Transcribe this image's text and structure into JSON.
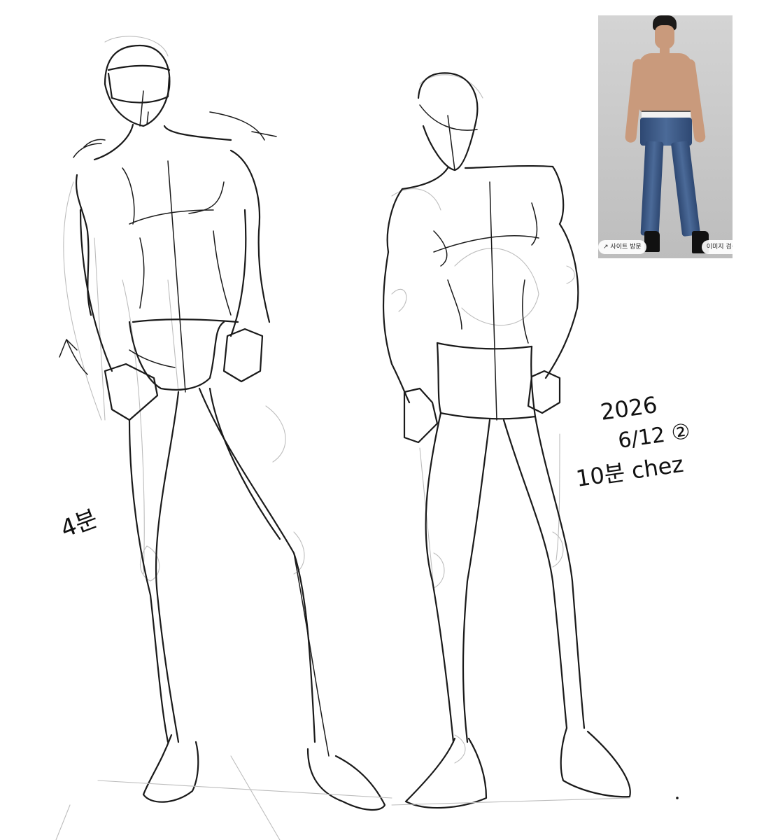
{
  "reference_photo": {
    "visit_label": "사이트 방문",
    "visit_icon": "arrow-up-right-icon",
    "search_label": "이미지 검색"
  },
  "annotations": {
    "left_time": "4분",
    "date_line1": "2026",
    "date_line2": "6/12 ②",
    "time_author": "10분 chez"
  }
}
